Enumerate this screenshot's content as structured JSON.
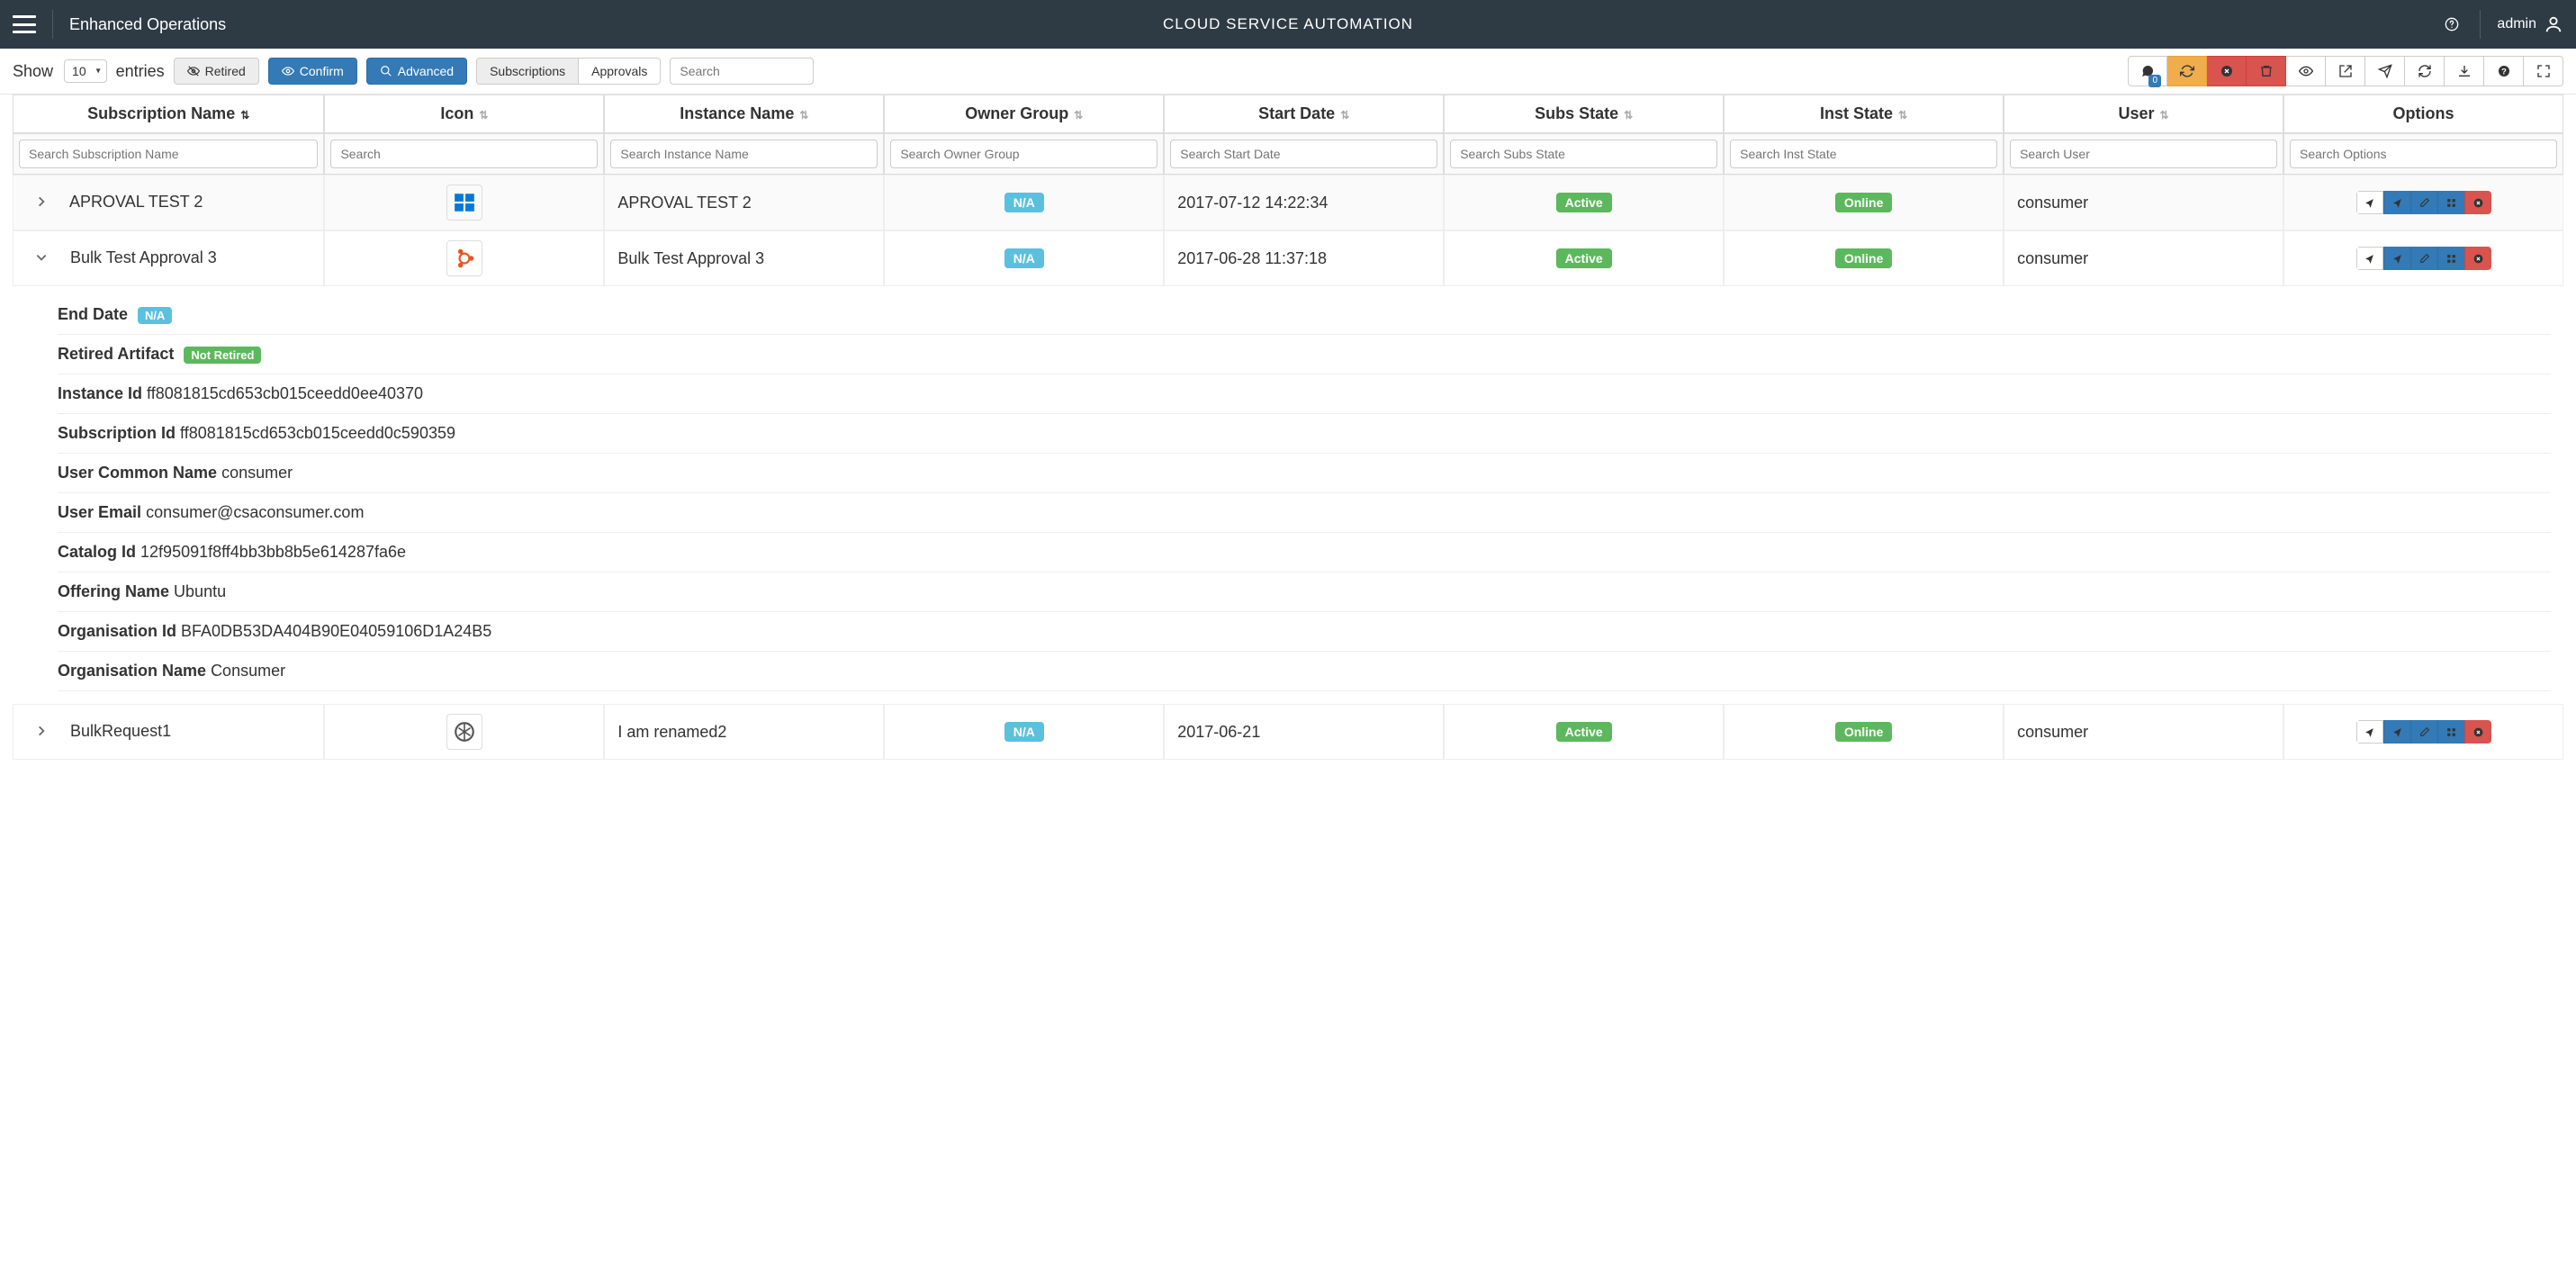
{
  "header": {
    "left_title": "Enhanced Operations",
    "center_title": "CLOUD SERVICE AUTOMATION",
    "user": "admin"
  },
  "toolbar": {
    "show_label": "Show",
    "entries_value": "10",
    "entries_label": "entries",
    "retired_label": "Retired",
    "confirm_label": "Confirm",
    "advanced_label": "Advanced",
    "tab_subscriptions": "Subscriptions",
    "tab_approvals": "Approvals",
    "search_placeholder": "Search",
    "chat_badge": "0"
  },
  "columns": {
    "sub_name": "Subscription Name",
    "icon": "Icon",
    "inst_name": "Instance Name",
    "owner_group": "Owner Group",
    "start_date": "Start Date",
    "subs_state": "Subs State",
    "inst_state": "Inst State",
    "user": "User",
    "options": "Options"
  },
  "filters": {
    "sub_name": "Search Subscription Name",
    "icon": "Search",
    "inst_name": "Search Instance Name",
    "owner_group": "Search Owner Group",
    "start_date": "Search Start Date",
    "subs_state": "Search Subs State",
    "inst_state": "Search Inst State",
    "user": "Search User",
    "options": "Search Options"
  },
  "rows": [
    {
      "sub_name": "APROVAL TEST 2",
      "icon_type": "windows",
      "inst_name": "APROVAL TEST 2",
      "owner_group": "N/A",
      "start_date": "2017-07-12 14:22:34",
      "subs_state": "Active",
      "inst_state": "Online",
      "user": "consumer",
      "expanded": false
    },
    {
      "sub_name": "Bulk Test Approval 3",
      "icon_type": "ubuntu",
      "inst_name": "Bulk Test Approval 3",
      "owner_group": "N/A",
      "start_date": "2017-06-28 11:37:18",
      "subs_state": "Active",
      "inst_state": "Online",
      "user": "consumer",
      "expanded": true,
      "details": [
        {
          "label": "End Date",
          "badge": "N/A",
          "badge_class": "na"
        },
        {
          "label": "Retired Artifact",
          "badge": "Not Retired",
          "badge_class": "active"
        },
        {
          "label": "Instance Id",
          "value": "ff8081815cd653cb015ceedd0ee40370"
        },
        {
          "label": "Subscription Id",
          "value": "ff8081815cd653cb015ceedd0c590359"
        },
        {
          "label": "User Common Name",
          "value": "consumer"
        },
        {
          "label": "User Email",
          "value": "consumer@csaconsumer.com"
        },
        {
          "label": "Catalog Id",
          "value": "12f95091f8ff4bb3bb8b5e614287fa6e"
        },
        {
          "label": "Offering Name",
          "value": "Ubuntu"
        },
        {
          "label": "Organisation Id",
          "value": "BFA0DB53DA404B90E04059106D1A24B5"
        },
        {
          "label": "Organisation Name",
          "value": "Consumer"
        }
      ]
    },
    {
      "sub_name": "BulkRequest1",
      "icon_type": "generic",
      "inst_name": "I am renamed2",
      "owner_group": "N/A",
      "start_date": "2017-06-21",
      "subs_state": "Active",
      "inst_state": "Online",
      "user": "consumer",
      "expanded": false
    }
  ]
}
